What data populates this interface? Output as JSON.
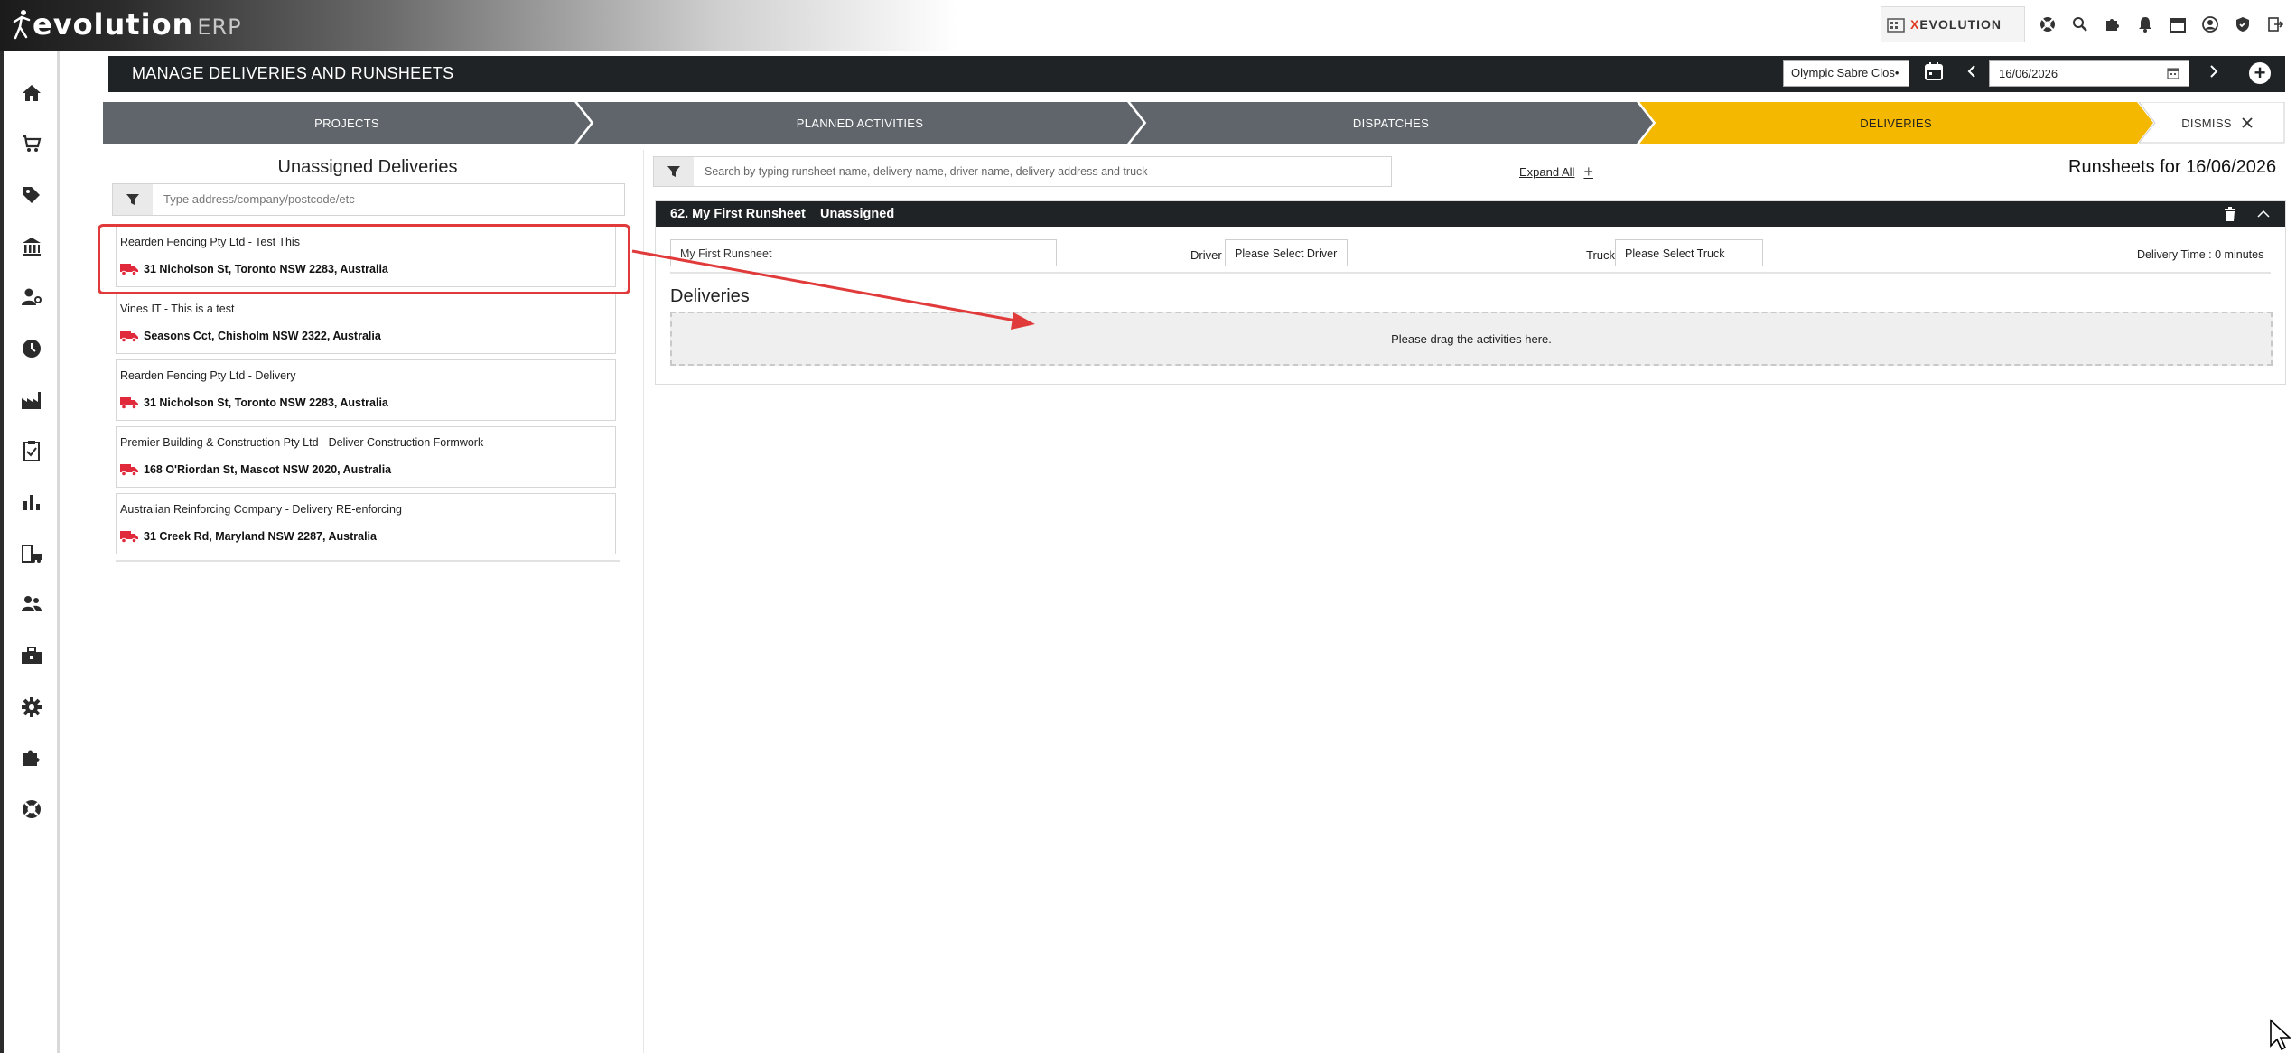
{
  "app": {
    "logo_main": "evolution",
    "logo_suffix": "ERP",
    "brand_name_a": "X",
    "brand_name_b": "EVOLUTION"
  },
  "header": {
    "title": "MANAGE DELIVERIES AND RUNSHEETS",
    "location_select": "Olympic Sabre Clos•",
    "date_value": "16/06/2026"
  },
  "steps": [
    {
      "label": "PROJECTS",
      "state": "done"
    },
    {
      "label": "PLANNED ACTIVITIES",
      "state": "done"
    },
    {
      "label": "DISPATCHES",
      "state": "done"
    },
    {
      "label": "DELIVERIES",
      "state": "active"
    },
    {
      "label": "DISMISS",
      "state": "dismiss"
    }
  ],
  "unassigned": {
    "title": "Unassigned Deliveries",
    "filter_placeholder": "Type address/company/postcode/etc",
    "items": [
      {
        "name": "Rearden Fencing Pty Ltd - Test This",
        "address": "31 Nicholson St, Toronto NSW 2283, Australia"
      },
      {
        "name": "Vines IT - This is a test",
        "address": "Seasons Cct, Chisholm NSW 2322, Australia"
      },
      {
        "name": "Rearden Fencing Pty Ltd - Delivery",
        "address": "31 Nicholson St, Toronto NSW 2283, Australia"
      },
      {
        "name": "Premier Building & Construction Pty Ltd - Deliver Construction Formwork",
        "address": "168 O'Riordan St, Mascot NSW 2020, Australia"
      },
      {
        "name": "Australian Reinforcing Company - Delivery RE-enforcing",
        "address": "31 Creek Rd, Maryland NSW 2287, Australia"
      }
    ]
  },
  "runsheets": {
    "search_placeholder": "Search by typing runsheet name, delivery name, driver name, delivery address and truck",
    "expand_all": "Expand All",
    "title": "Runsheets for 16/06/2026",
    "card": {
      "title": "62. My First Runsheet",
      "status": "Unassigned",
      "name_value": "My First Runsheet",
      "driver_label": "Driver",
      "driver_value": "Please Select Driver",
      "truck_label": "Truck",
      "truck_value": "Please Select Truck",
      "delivery_time": "Delivery Time : 0 minutes",
      "deliveries_label": "Deliveries",
      "dropzone_text": "Please drag the activities here."
    }
  },
  "colors": {
    "dark": "#1f2326",
    "step_done": "#5f656b",
    "step_active": "#f5b800",
    "truck_red": "#e0293a",
    "annotation_red": "#e03a3a"
  },
  "sidebar_icons": [
    "home-icon",
    "cart-icon",
    "tag-icon",
    "bank-icon",
    "user-settings-icon",
    "clock-icon",
    "factory-icon",
    "clipboard-check-icon",
    "bar-chart-icon",
    "building-car-icon",
    "people-icon",
    "toolbox-icon",
    "gear-icon",
    "puzzle-icon",
    "lifebuoy-icon"
  ]
}
